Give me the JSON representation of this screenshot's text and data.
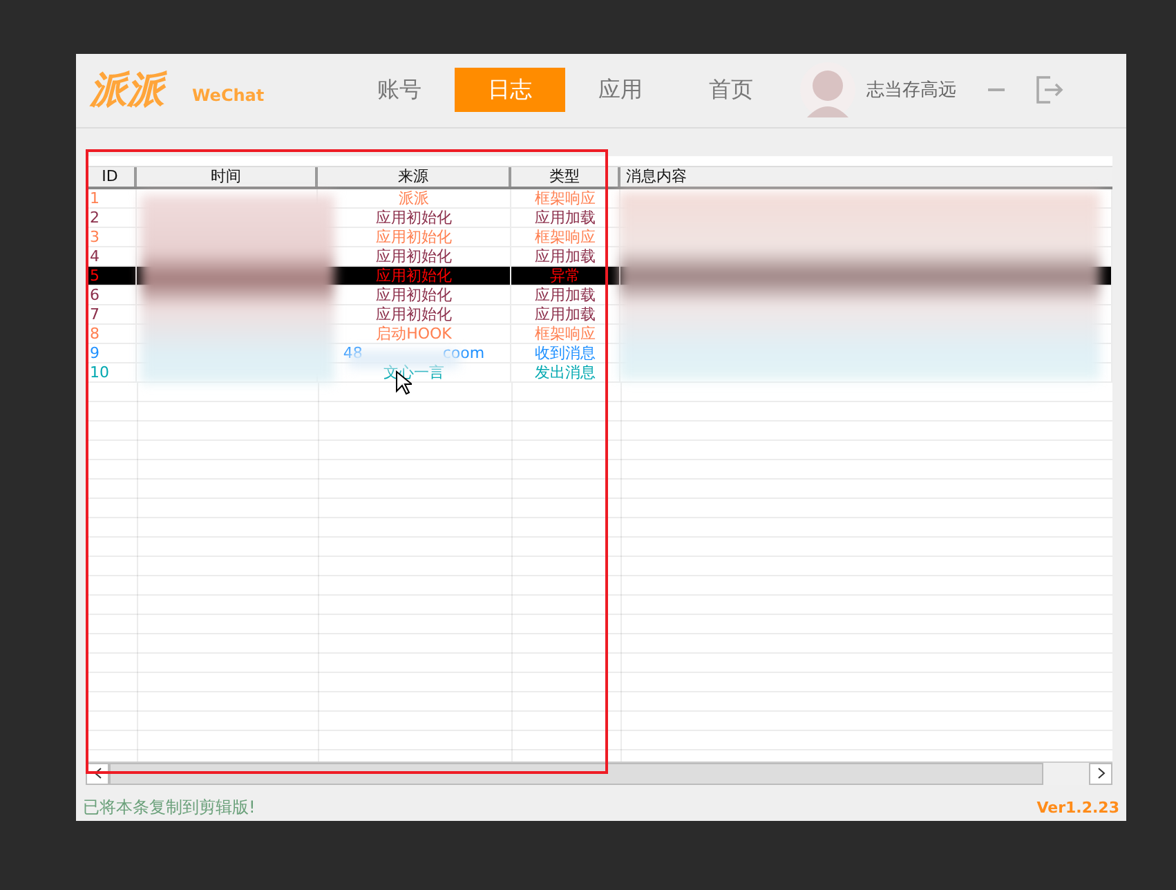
{
  "app": {
    "logo": "派派",
    "subtitle": "WeChat"
  },
  "tabs": [
    {
      "label": "账号",
      "selected": false
    },
    {
      "label": "日志",
      "selected": true
    },
    {
      "label": "应用",
      "selected": false
    },
    {
      "label": "首页",
      "selected": false
    }
  ],
  "user": {
    "name": "志当存高远"
  },
  "table": {
    "columns": [
      "ID",
      "时间",
      "来源",
      "类型",
      "消息内容"
    ],
    "rows": [
      {
        "id": "1",
        "source": "派派",
        "type": "框架响应",
        "color": "#ff7f50",
        "selected": false
      },
      {
        "id": "2",
        "source": "应用初始化",
        "type": "应用加载",
        "color": "#8b2e4a",
        "selected": false
      },
      {
        "id": "3",
        "source": "应用初始化",
        "type": "框架响应",
        "color": "#ff7f50",
        "selected": false
      },
      {
        "id": "4",
        "source": "应用初始化",
        "type": "应用加载",
        "color": "#8b2e4a",
        "selected": false
      },
      {
        "id": "5",
        "source": "应用初始化",
        "type": "异常",
        "color": "#ff0000",
        "selected": true
      },
      {
        "id": "6",
        "source": "应用初始化",
        "type": "应用加载",
        "color": "#8b2e4a",
        "selected": false
      },
      {
        "id": "7",
        "source": "应用初始化",
        "type": "应用加载",
        "color": "#8b2e4a",
        "selected": false
      },
      {
        "id": "8",
        "source": "启动HOOK",
        "type": "框架响应",
        "color": "#ff7f50",
        "selected": false
      },
      {
        "id": "9",
        "source": "48",
        "source_tail": "coom",
        "type": "收到消息",
        "color": "#1e90ff",
        "selected": false
      },
      {
        "id": "10",
        "source": "文心一言",
        "type": "发出消息",
        "color": "#00a8b0",
        "selected": false
      }
    ]
  },
  "status_bar": {
    "message": "已将本条复制到剪辑版!",
    "version": "Ver1.2.23"
  }
}
